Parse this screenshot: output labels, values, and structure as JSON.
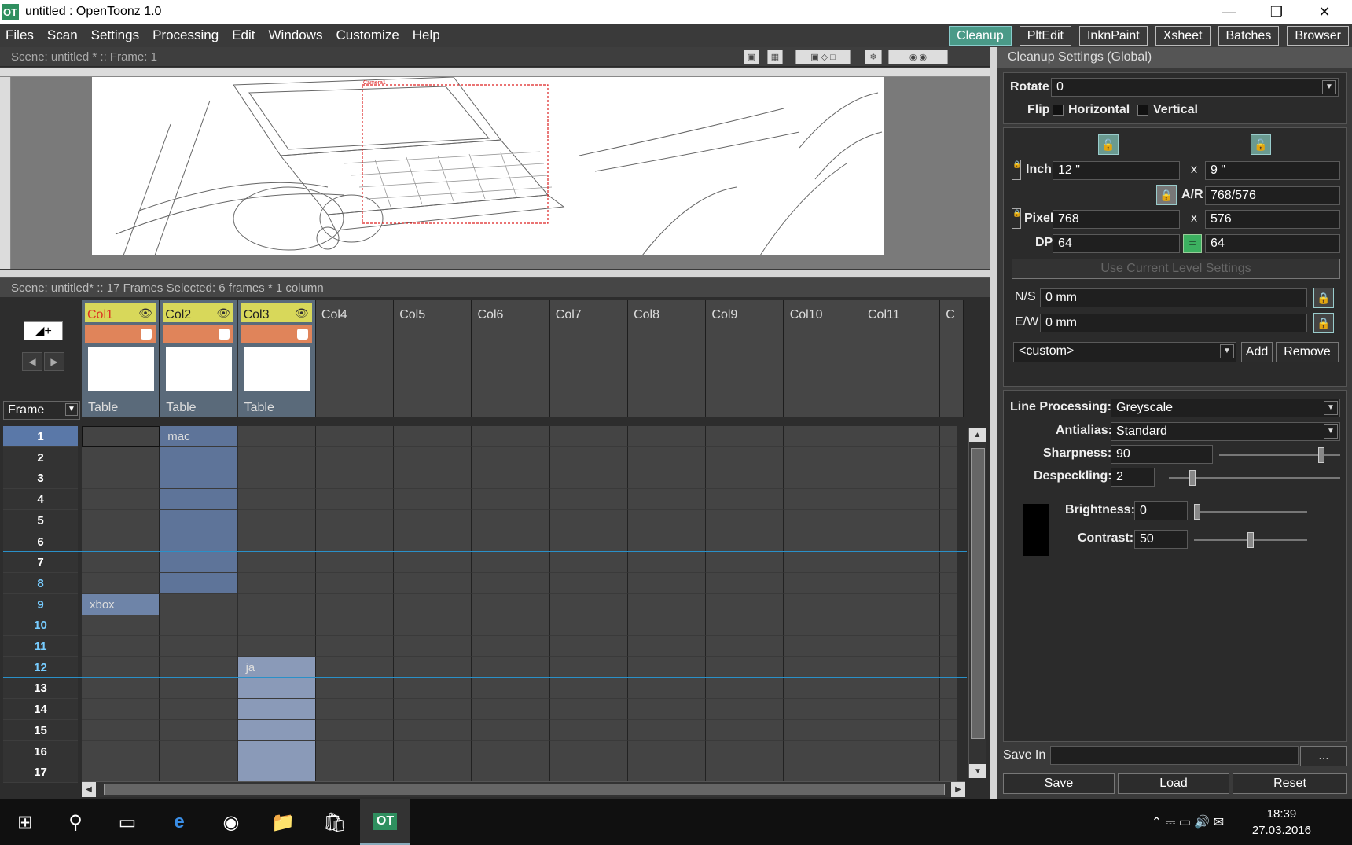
{
  "window": {
    "title": "untitled : OpenToonz 1.0",
    "app_icon": "OT"
  },
  "menus": [
    "Files",
    "Scan",
    "Settings",
    "Processing",
    "Edit",
    "Windows",
    "Customize",
    "Help"
  ],
  "rooms": [
    {
      "label": "Cleanup",
      "active": true
    },
    {
      "label": "PltEdit",
      "active": false
    },
    {
      "label": "InknPaint",
      "active": false
    },
    {
      "label": "Xsheet",
      "active": false
    },
    {
      "label": "Batches",
      "active": false
    },
    {
      "label": "Browser",
      "active": false
    }
  ],
  "viewer": {
    "scene": "Scene: untitled *   ::  Frame: 1",
    "camera_label": "Camera1"
  },
  "xsheet": {
    "status": "Scene: untitled*   ::  17 Frames   Selected: 6 frames * 1 column",
    "frame_header": "Frame",
    "columns": [
      "Col1",
      "Col2",
      "Col3",
      "Col4",
      "Col5",
      "Col6",
      "Col7",
      "Col8",
      "Col9",
      "Col10",
      "Col11",
      "C"
    ],
    "table_label": "Table",
    "rows": [
      "1",
      "2",
      "3",
      "4",
      "5",
      "6",
      "7",
      "8",
      "9",
      "10",
      "11",
      "12",
      "13",
      "14",
      "15",
      "16",
      "17"
    ],
    "levels": {
      "col1": "xbox",
      "col2": "mac",
      "col3": "ja"
    }
  },
  "cleanup": {
    "title": "Cleanup Settings (Global)",
    "rotate_label": "Rotate",
    "rotate_value": "0",
    "flip_label": "Flip",
    "horizontal": "Horizontal",
    "vertical": "Vertical",
    "inch_label": "Inch",
    "inch_w": "12 \"",
    "inch_h": "9 \"",
    "x": "x",
    "ar_label": "A/R",
    "ar_value": "768/576",
    "pixel_label": "Pixel",
    "pixel_w": "768",
    "pixel_h": "576",
    "dpi_label": "DPI",
    "dpi_x": "64",
    "dpi_y": "64",
    "use_current": "Use Current Level Settings",
    "ns_label": "N/S",
    "ns_value": "0 mm",
    "ew_label": "E/W",
    "ew_value": "0 mm",
    "preset": "<custom>",
    "add": "Add",
    "remove": "Remove",
    "line_proc_label": "Line Processing:",
    "line_proc": "Greyscale",
    "antialias_label": "Antialias:",
    "antialias": "Standard",
    "sharpness_label": "Sharpness:",
    "sharpness": "90",
    "despeckling_label": "Despeckling:",
    "despeckling": "2",
    "brightness_label": "Brightness:",
    "brightness": "0",
    "contrast_label": "Contrast:",
    "contrast": "50",
    "save_in_label": "Save In",
    "browse": "...",
    "save": "Save",
    "load": "Load",
    "reset": "Reset"
  },
  "taskbar": {
    "time": "18:39",
    "date": "27.03.2016"
  }
}
